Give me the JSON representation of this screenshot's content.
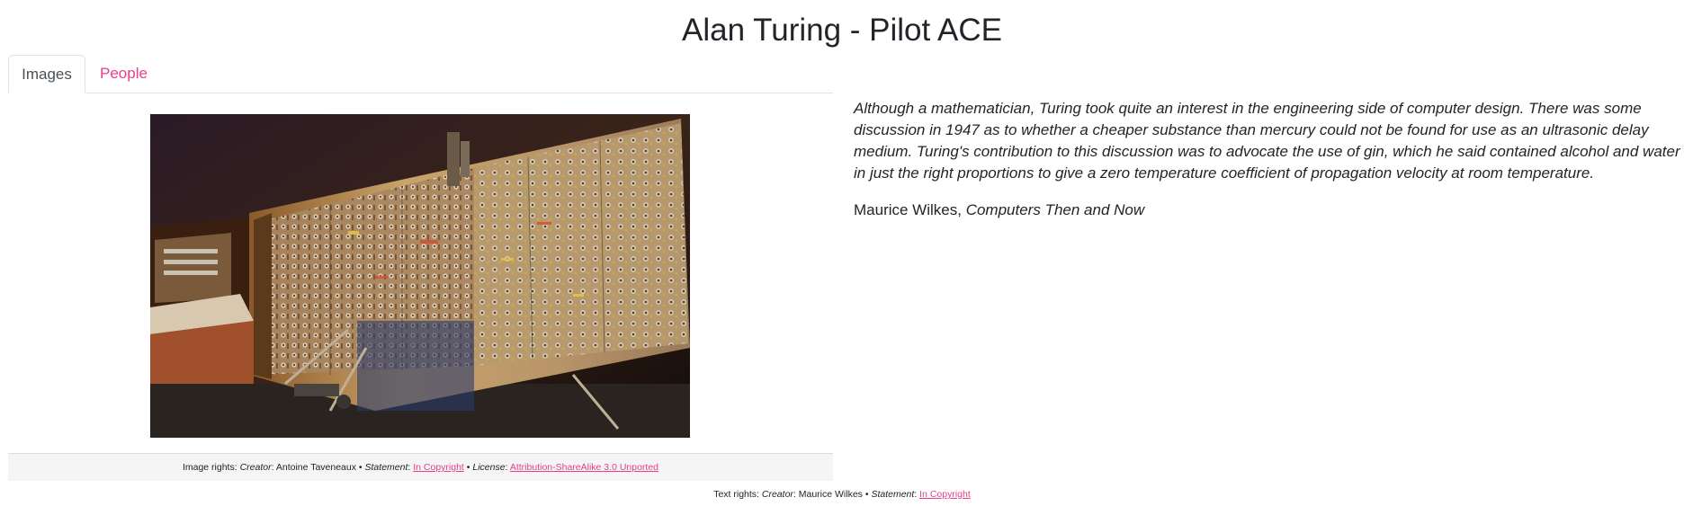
{
  "page": {
    "title": "Alan Turing - Pilot ACE"
  },
  "tabs": [
    {
      "label": "Images",
      "active": true
    },
    {
      "label": "People",
      "active": false
    }
  ],
  "image": {
    "alt": "Pilot ACE computer on display"
  },
  "image_rights": {
    "prefix": "Image rights: ",
    "creator_label": "Creator",
    "creator": "Antoine Taveneaux",
    "statement_label": "Statement",
    "statement": "In Copyright",
    "license_label": "License",
    "license": "Attribution-ShareAlike 3.0 Unported",
    "separator": " • "
  },
  "quote": {
    "text": "Although a mathematician, Turing took quite an interest in the engineering side of computer design. There was some discussion in 1947 as to whether a cheaper substance than mercury could not be found for use as an ultrasonic delay medium. Turing's contribution to this discussion was to advocate the use of gin, which he said contained alcohol and water in just the right proportions to give a zero temperature coefficient of propagation velocity at room temperature.",
    "author": "Maurice Wilkes,",
    "source": "Computers Then and Now"
  },
  "text_rights": {
    "prefix": "Text rights: ",
    "creator_label": "Creator",
    "creator": "Maurice Wilkes",
    "statement_label": "Statement",
    "statement": "In Copyright",
    "separator": " • "
  },
  "colors": {
    "link": "#e83e8c",
    "text": "#212529",
    "caption_bg": "#f5f5f5"
  }
}
